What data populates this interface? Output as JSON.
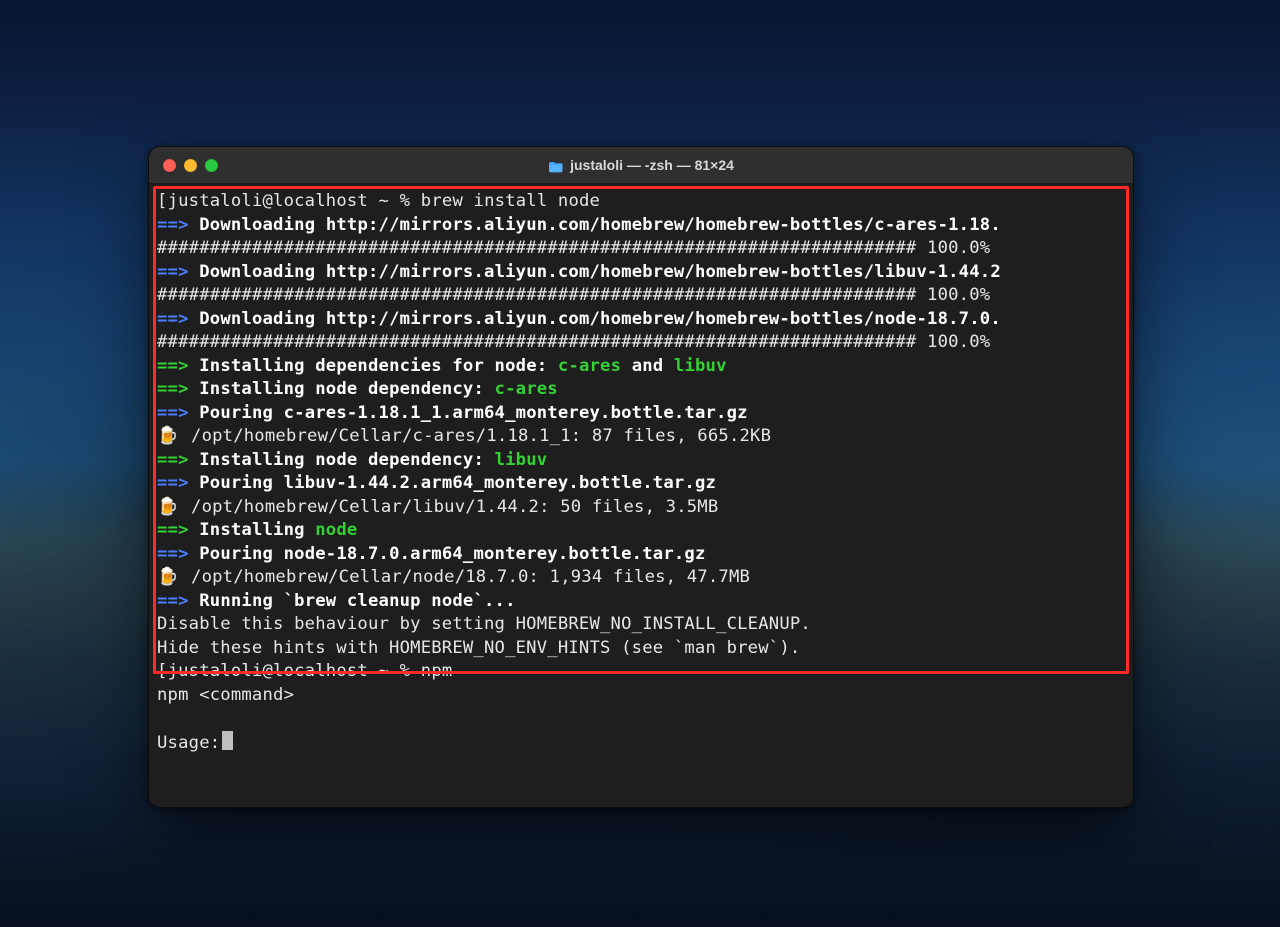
{
  "window": {
    "title": "justaloli — -zsh — 81×24"
  },
  "prompt1": {
    "user_host": "justaloli@localhost",
    "path_sym": "~",
    "percent": "%",
    "cmd": "brew install node"
  },
  "dl1": {
    "arrow": "==>",
    "label": "Downloading",
    "url": "http://mirrors.aliyun.com/homebrew/homebrew-bottles/c-ares-1.18."
  },
  "bar1": {
    "hashes": "########################################################################",
    "pct": "100.0%"
  },
  "dl2": {
    "arrow": "==>",
    "label": "Downloading",
    "url": "http://mirrors.aliyun.com/homebrew/homebrew-bottles/libuv-1.44.2"
  },
  "bar2": {
    "hashes": "########################################################################",
    "pct": "100.0%"
  },
  "dl3": {
    "arrow": "==>",
    "label": "Downloading",
    "url": "http://mirrors.aliyun.com/homebrew/homebrew-bottles/node-18.7.0."
  },
  "bar3": {
    "hashes": "########################################################################",
    "pct": "100.0%"
  },
  "deps": {
    "arrow": "==>",
    "text": "Installing dependencies for node: ",
    "d1": "c-ares",
    "and": " and ",
    "d2": "libuv"
  },
  "instCares": {
    "arrow": "==>",
    "text": "Installing node dependency: ",
    "name": "c-ares"
  },
  "pourCares": {
    "arrow": "==>",
    "text": "Pouring c-ares-1.18.1_1.arm64_monterey.bottle.tar.gz"
  },
  "pathCares": "  /opt/homebrew/Cellar/c-ares/1.18.1_1: 87 files, 665.2KB",
  "instLibuv": {
    "arrow": "==>",
    "text": "Installing node dependency: ",
    "name": "libuv"
  },
  "pourLibuv": {
    "arrow": "==>",
    "text": "Pouring libuv-1.44.2.arm64_monterey.bottle.tar.gz"
  },
  "pathLibuv": "  /opt/homebrew/Cellar/libuv/1.44.2: 50 files, 3.5MB",
  "instNode": {
    "arrow": "==>",
    "text": "Installing ",
    "name": "node"
  },
  "pourNode": {
    "arrow": "==>",
    "text": "Pouring node-18.7.0.arm64_monterey.bottle.tar.gz"
  },
  "pathNode": "  /opt/homebrew/Cellar/node/18.7.0: 1,934 files, 47.7MB",
  "cleanup": {
    "arrow": "==>",
    "text": "Running `brew cleanup node`..."
  },
  "hint1": "Disable this behaviour by setting HOMEBREW_NO_INSTALL_CLEANUP.",
  "hint2": "Hide these hints with HOMEBREW_NO_ENV_HINTS (see `man brew`).",
  "prompt2": {
    "user_host": "justaloli@localhost",
    "path_sym": "~",
    "percent": "%",
    "cmd": "npm"
  },
  "npmLine": "npm <command>",
  "usage": "Usage:",
  "beer": "🍺"
}
